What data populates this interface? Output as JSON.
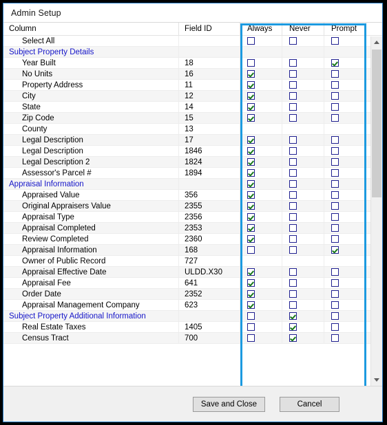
{
  "window": {
    "title": "Admin Setup"
  },
  "grid": {
    "headers": {
      "column": "Column",
      "field_id": "Field ID",
      "always": "Always",
      "never": "Never",
      "prompt": "Prompt"
    },
    "rows": [
      {
        "label": "Select All",
        "field_id": "",
        "kind": "item",
        "always": false,
        "never": false,
        "prompt": false,
        "boxes": true,
        "stripe": "white"
      },
      {
        "label": "Subject Property Details",
        "field_id": "",
        "kind": "group",
        "always": false,
        "never": false,
        "prompt": false,
        "boxes": false,
        "stripe": "alt"
      },
      {
        "label": "Year Built",
        "field_id": "18",
        "kind": "item",
        "always": false,
        "never": false,
        "prompt": true,
        "boxes": true,
        "stripe": "white"
      },
      {
        "label": "No Units",
        "field_id": "16",
        "kind": "item",
        "always": true,
        "never": false,
        "prompt": false,
        "boxes": true,
        "stripe": "alt"
      },
      {
        "label": "Property Address",
        "field_id": "11",
        "kind": "item",
        "always": true,
        "never": false,
        "prompt": false,
        "boxes": true,
        "stripe": "white"
      },
      {
        "label": "City",
        "field_id": "12",
        "kind": "item",
        "always": true,
        "never": false,
        "prompt": false,
        "boxes": true,
        "stripe": "alt"
      },
      {
        "label": "State",
        "field_id": "14",
        "kind": "item",
        "always": true,
        "never": false,
        "prompt": false,
        "boxes": true,
        "stripe": "white"
      },
      {
        "label": "Zip Code",
        "field_id": "15",
        "kind": "item",
        "always": true,
        "never": false,
        "prompt": false,
        "boxes": true,
        "stripe": "alt"
      },
      {
        "label": "County",
        "field_id": "13",
        "kind": "item",
        "always": false,
        "never": false,
        "prompt": false,
        "boxes": false,
        "stripe": "white"
      },
      {
        "label": "Legal Description",
        "field_id": "17",
        "kind": "item",
        "always": true,
        "never": false,
        "prompt": false,
        "boxes": true,
        "stripe": "alt"
      },
      {
        "label": "Legal Description",
        "field_id": "1846",
        "kind": "item",
        "always": true,
        "never": false,
        "prompt": false,
        "boxes": true,
        "stripe": "white"
      },
      {
        "label": "Legal Description 2",
        "field_id": "1824",
        "kind": "item",
        "always": true,
        "never": false,
        "prompt": false,
        "boxes": true,
        "stripe": "alt"
      },
      {
        "label": "Assessor's Parcel #",
        "field_id": "1894",
        "kind": "item",
        "always": true,
        "never": false,
        "prompt": false,
        "boxes": true,
        "stripe": "white"
      },
      {
        "label": "Appraisal Information",
        "field_id": "",
        "kind": "group",
        "always": true,
        "never": false,
        "prompt": false,
        "boxes": true,
        "stripe": "alt"
      },
      {
        "label": "Appraised Value",
        "field_id": "356",
        "kind": "item",
        "always": true,
        "never": false,
        "prompt": false,
        "boxes": true,
        "stripe": "white"
      },
      {
        "label": "Original Appraisers Value",
        "field_id": "2355",
        "kind": "item",
        "always": true,
        "never": false,
        "prompt": false,
        "boxes": true,
        "stripe": "alt"
      },
      {
        "label": "Appraisal Type",
        "field_id": "2356",
        "kind": "item",
        "always": true,
        "never": false,
        "prompt": false,
        "boxes": true,
        "stripe": "white"
      },
      {
        "label": "Appraisal Completed",
        "field_id": "2353",
        "kind": "item",
        "always": true,
        "never": false,
        "prompt": false,
        "boxes": true,
        "stripe": "alt"
      },
      {
        "label": "Review Completed",
        "field_id": "2360",
        "kind": "item",
        "always": true,
        "never": false,
        "prompt": false,
        "boxes": true,
        "stripe": "white"
      },
      {
        "label": "Appraisal Information",
        "field_id": "168",
        "kind": "item",
        "always": false,
        "never": false,
        "prompt": true,
        "boxes": true,
        "stripe": "alt"
      },
      {
        "label": "Owner of Public Record",
        "field_id": "727",
        "kind": "item",
        "always": false,
        "never": false,
        "prompt": false,
        "boxes": false,
        "stripe": "white"
      },
      {
        "label": "Appraisal Effective Date",
        "field_id": "ULDD.X30",
        "kind": "item",
        "always": true,
        "never": false,
        "prompt": false,
        "boxes": true,
        "stripe": "alt"
      },
      {
        "label": "Appraisal Fee",
        "field_id": "641",
        "kind": "item",
        "always": true,
        "never": false,
        "prompt": false,
        "boxes": true,
        "stripe": "white"
      },
      {
        "label": "Order Date",
        "field_id": "2352",
        "kind": "item",
        "always": true,
        "never": false,
        "prompt": false,
        "boxes": true,
        "stripe": "alt"
      },
      {
        "label": "Appraisal Management Company",
        "field_id": "623",
        "kind": "item",
        "always": true,
        "never": false,
        "prompt": false,
        "boxes": true,
        "stripe": "white"
      },
      {
        "label": "Subject Property Additional Information",
        "field_id": "",
        "kind": "group",
        "always": false,
        "never": true,
        "prompt": false,
        "boxes": true,
        "stripe": "alt"
      },
      {
        "label": "Real Estate Taxes",
        "field_id": "1405",
        "kind": "item",
        "always": false,
        "never": true,
        "prompt": false,
        "boxes": true,
        "stripe": "white"
      },
      {
        "label": "Census Tract",
        "field_id": "700",
        "kind": "item",
        "always": false,
        "never": true,
        "prompt": false,
        "boxes": true,
        "stripe": "alt"
      }
    ]
  },
  "scrollbar": {
    "up_arrow": "˄",
    "down_arrow": "˅"
  },
  "footer": {
    "save_label": "Save and Close",
    "cancel_label": "Cancel"
  },
  "colors": {
    "focus_highlight": "#1c9ae0",
    "group_text": "#1414c8",
    "check_green": "#1a7a1a",
    "checkbox_border": "#1f1f8f"
  }
}
